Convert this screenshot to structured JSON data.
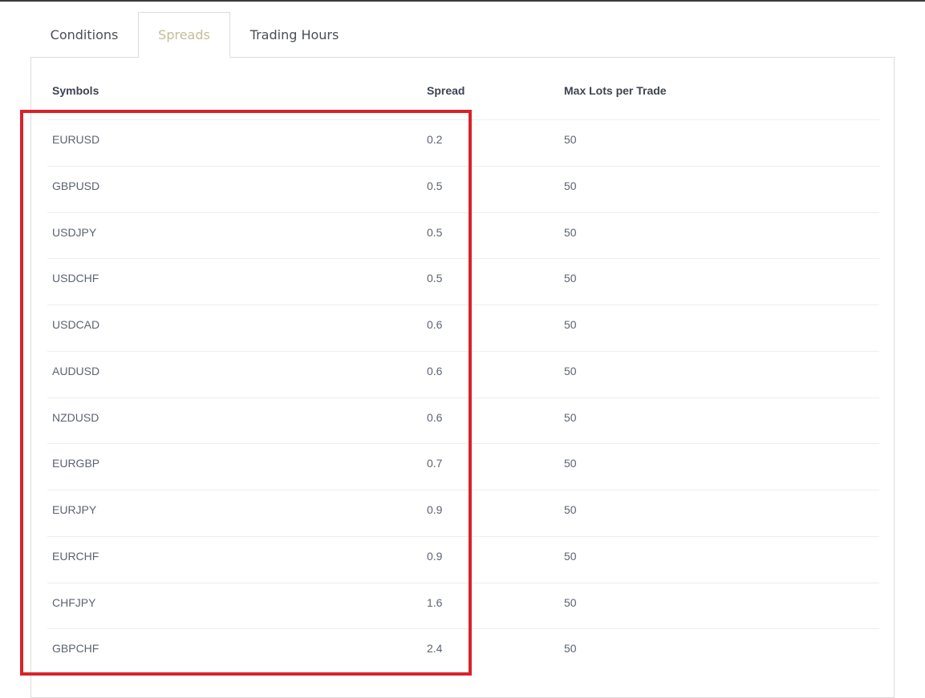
{
  "tabs": [
    {
      "label": "Conditions"
    },
    {
      "label": "Spreads"
    },
    {
      "label": "Trading Hours"
    }
  ],
  "active_tab": "Spreads",
  "table": {
    "headers": [
      "Symbols",
      "Spread",
      "Max Lots per Trade"
    ],
    "rows": [
      {
        "symbol": "EURUSD",
        "spread": "0.2",
        "max_lots": "50"
      },
      {
        "symbol": "GBPUSD",
        "spread": "0.5",
        "max_lots": "50"
      },
      {
        "symbol": "USDJPY",
        "spread": "0.5",
        "max_lots": "50"
      },
      {
        "symbol": "USDCHF",
        "spread": "0.5",
        "max_lots": "50"
      },
      {
        "symbol": "USDCAD",
        "spread": "0.6",
        "max_lots": "50"
      },
      {
        "symbol": "AUDUSD",
        "spread": "0.6",
        "max_lots": "50"
      },
      {
        "symbol": "NZDUSD",
        "spread": "0.6",
        "max_lots": "50"
      },
      {
        "symbol": "EURGBP",
        "spread": "0.7",
        "max_lots": "50"
      },
      {
        "symbol": "EURJPY",
        "spread": "0.9",
        "max_lots": "50"
      },
      {
        "symbol": "EURCHF",
        "spread": "0.9",
        "max_lots": "50"
      },
      {
        "symbol": "CHFJPY",
        "spread": "1.6",
        "max_lots": "50"
      },
      {
        "symbol": "GBPCHF",
        "spread": "2.4",
        "max_lots": "50"
      }
    ]
  },
  "colors": {
    "active_tab_text": "#c7bb97",
    "highlight_border": "#d8232a"
  }
}
